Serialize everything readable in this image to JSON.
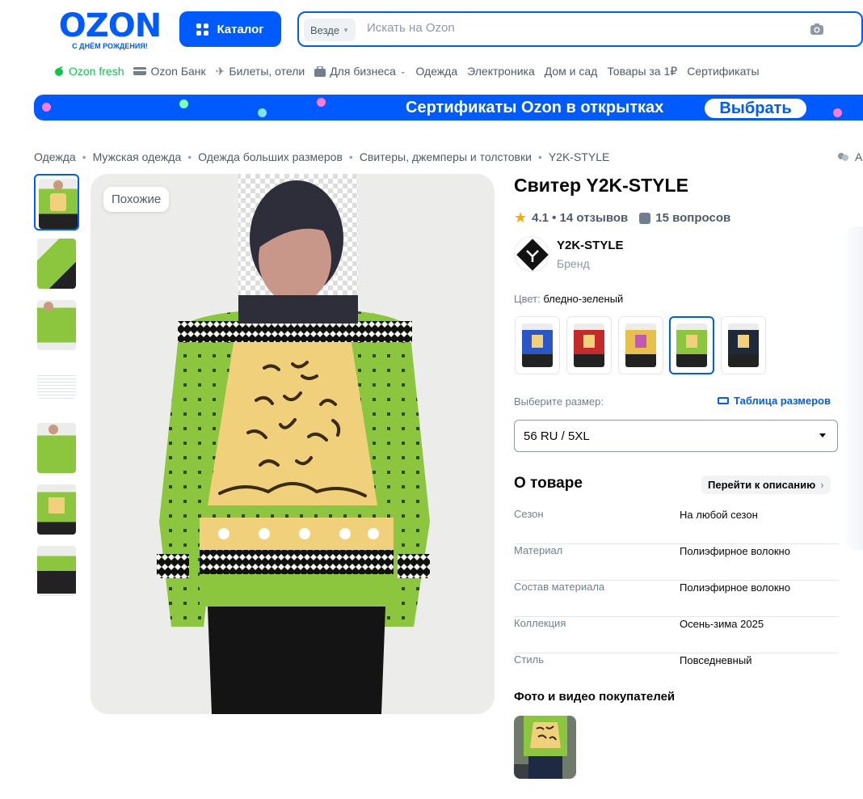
{
  "header": {
    "logo_text": "OZON",
    "logo_sub": "С ДНЁМ РОЖДЕНИЯ!",
    "catalog_label": "Каталог",
    "search_scope": "Везде",
    "search_placeholder": "Искать на Ozon"
  },
  "topnav": {
    "items": [
      "Ozon fresh",
      "Ozon Банк",
      "Билеты, отели",
      "Для бизнеса",
      "Одежда",
      "Электроника",
      "Дом и сад",
      "Товары за 1₽",
      "Сертификаты"
    ]
  },
  "banner": {
    "text": "Сертификаты Ozon в открытках",
    "button": "Выбрать"
  },
  "breadcrumb": [
    "Одежда",
    "Мужская одежда",
    "Одежда больших размеров",
    "Свитеры, джемперы и толстовки",
    "Y2K-STYLE"
  ],
  "share_label": "А",
  "gallery": {
    "similar_label": "Похожие"
  },
  "product": {
    "title": "Свитер Y2K-STYLE",
    "rating": "4.1 • 14 отзывов",
    "questions": "15 вопросов",
    "brand_name": "Y2K-STYLE",
    "brand_sub": "Бренд",
    "color_label": "Цвет:",
    "color_value": "бледно-зеленый",
    "size_label": "Выберите размер:",
    "size_table_label": "Таблица размеров",
    "size_selected": "56 RU / 5XL"
  },
  "about": {
    "title": "О товаре",
    "link": "Перейти к описанию",
    "specs": [
      {
        "key": "Сезон",
        "value": "На любой сезон"
      },
      {
        "key": "Материал",
        "value": "Полиэфирное волокно"
      },
      {
        "key": "Состав материала",
        "value": "Полиэфирное волокно"
      },
      {
        "key": "Коллекция",
        "value": "Осень-зима 2025"
      },
      {
        "key": "Стиль",
        "value": "Повседневный"
      }
    ]
  },
  "ugc": {
    "title": "Фото и видео покупателей"
  },
  "colors": {
    "accent": "#005bff",
    "sweater_green": "#8cc63f",
    "sweater_yellow": "#f0d07a",
    "star": "#ffa800"
  }
}
